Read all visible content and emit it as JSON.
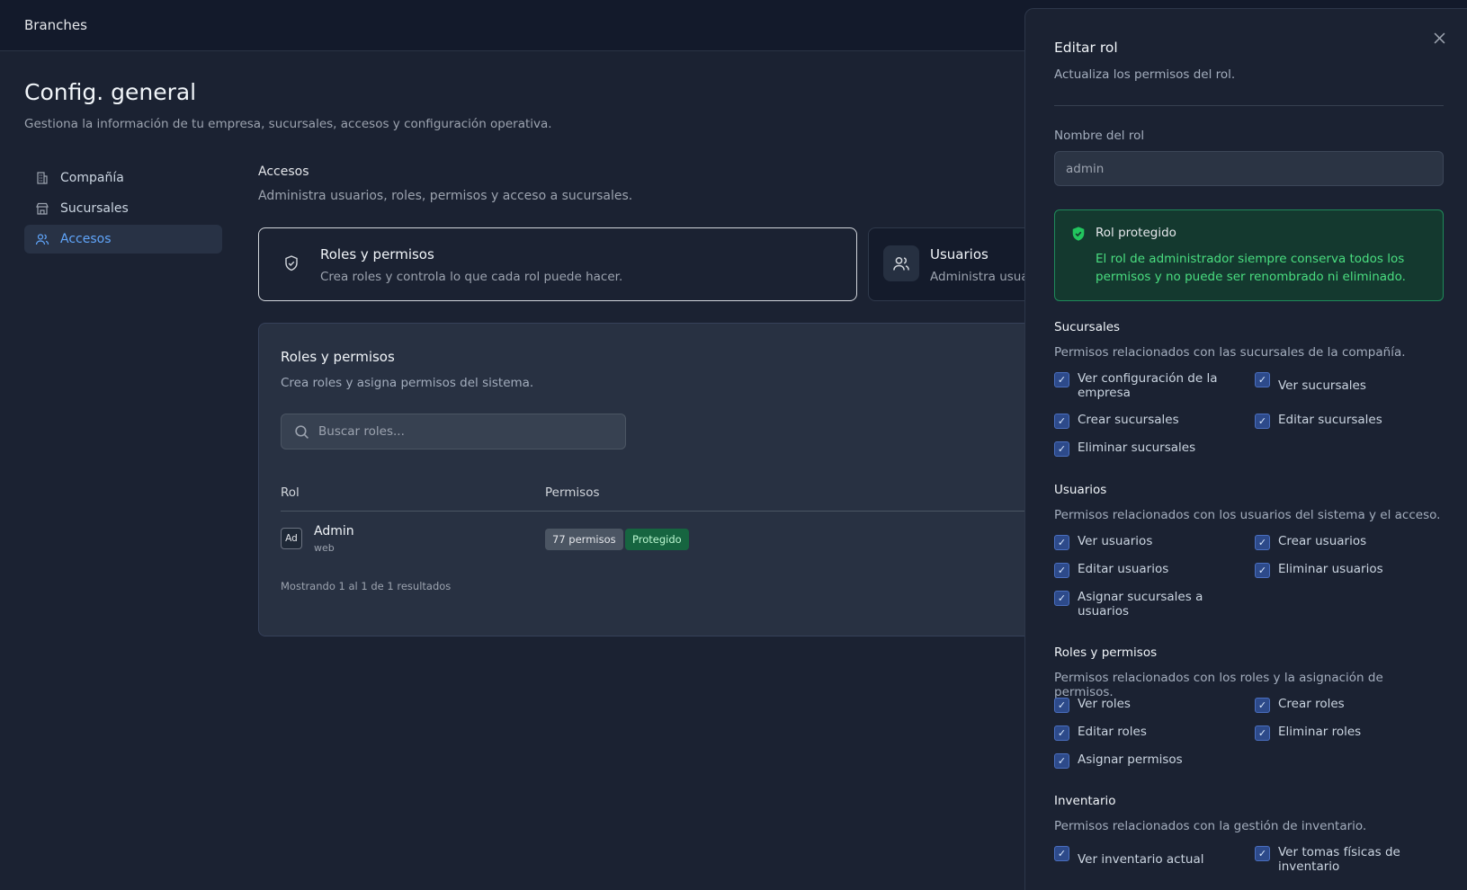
{
  "topbar": {
    "brand": "Branches"
  },
  "page": {
    "title": "Config. general",
    "subtitle": "Gestiona la información de tu empresa, sucursales, accesos y configuración operativa."
  },
  "sidebar": {
    "items": [
      {
        "label": "Compañía",
        "icon": "building-icon",
        "active": false
      },
      {
        "label": "Sucursales",
        "icon": "store-icon",
        "active": false
      },
      {
        "label": "Accesos",
        "icon": "users-icon",
        "active": true
      }
    ]
  },
  "section": {
    "title": "Accesos",
    "subtitle": "Administra usuarios, roles, permisos y acceso a sucursales."
  },
  "tiles": [
    {
      "title": "Roles y permisos",
      "subtitle": "Crea roles y controla lo que cada rol puede hacer.",
      "icon": "shield-check-icon"
    },
    {
      "title": "Usuarios",
      "subtitle": "Administra usuar",
      "icon": "users-icon"
    }
  ],
  "card": {
    "title": "Roles y permisos",
    "subtitle": "Crea roles y asigna permisos del sistema.",
    "search_placeholder": "Buscar roles...",
    "columns": {
      "role": "Rol",
      "permissions": "Permisos"
    },
    "rows": [
      {
        "avatar": "Ad",
        "name": "Admin",
        "guard": "web",
        "perm_count": "77 permisos",
        "badge": "Protegido"
      }
    ],
    "footer": "Mostrando 1 al 1 de 1 resultados"
  },
  "drawer": {
    "title": "Editar rol",
    "subtitle": "Actualiza los permisos del rol.",
    "name_label": "Nombre del rol",
    "name_value": "admin",
    "alert": {
      "title": "Rol protegido",
      "body": "El rol de administrador siempre conserva todos los permisos y no puede ser renombrado ni eliminado."
    },
    "groups": [
      {
        "title": "Sucursales",
        "subtitle": "Permisos relacionados con las sucursales de la compañía.",
        "perms": [
          "Ver configuración de la empresa",
          "Ver sucursales",
          "Crear sucursales",
          "Editar sucursales",
          "Eliminar sucursales"
        ]
      },
      {
        "title": "Usuarios",
        "subtitle": "Permisos relacionados con los usuarios del sistema y el acceso.",
        "perms": [
          "Ver usuarios",
          "Crear usuarios",
          "Editar usuarios",
          "Eliminar usuarios",
          "Asignar sucursales a usuarios"
        ]
      },
      {
        "title": "Roles y permisos",
        "subtitle": "Permisos relacionados con los roles y la asignación de permisos.",
        "perms": [
          "Ver roles",
          "Crear roles",
          "Editar roles",
          "Eliminar roles",
          "Asignar permisos"
        ]
      },
      {
        "title": "Inventario",
        "subtitle": "Permisos relacionados con la gestión de inventario.",
        "perms": [
          "Ver inventario actual",
          "Ver tomas físicas de inventario"
        ]
      }
    ]
  },
  "colors": {
    "accent": "#60a5fa",
    "success": "#4ade80",
    "checkbox": "#2d4a8a"
  }
}
